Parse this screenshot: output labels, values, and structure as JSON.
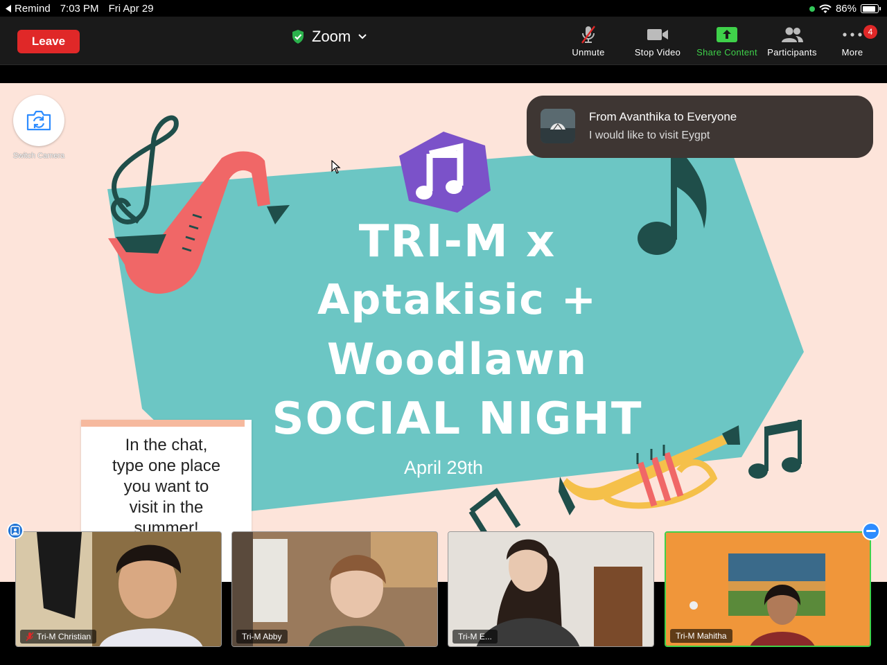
{
  "status_bar": {
    "back_app": "Remind",
    "time": "7:03 PM",
    "date": "Fri Apr 29",
    "battery": "86%",
    "battery_level": 0.86
  },
  "toolbar": {
    "leave_label": "Leave",
    "meeting_title": "Zoom",
    "buttons": [
      {
        "label": "Unmute",
        "icon": "mic-muted-icon"
      },
      {
        "label": "Stop Video",
        "icon": "video-camera-icon"
      },
      {
        "label": "Share Content",
        "icon": "share-arrow-icon"
      },
      {
        "label": "Participants",
        "icon": "participants-icon"
      },
      {
        "label": "More",
        "icon": "more-dots-icon",
        "badge": "4"
      }
    ],
    "share_color": "#3fd14a",
    "leave_color": "#e02828"
  },
  "switch_camera": {
    "label": "Switch Camera"
  },
  "chat_notification": {
    "from": "From Avanthika to Everyone",
    "message": "I would like to visit Eygpt"
  },
  "slide": {
    "title_lines": [
      "TRI-M x",
      "Aptakisic +",
      "Woodlawn",
      "SOCIAL NIGHT"
    ],
    "date": "April 29th",
    "note_lines": [
      "In the chat,",
      "type one place",
      "you want to",
      "visit in the",
      "summer!"
    ],
    "colors": {
      "background": "#fde4da",
      "panel": "#6cc6c4",
      "hexagon": "#7b52c9",
      "accent_red": "#f06767",
      "accent_yellow": "#f5c04a",
      "dark_teal": "#1f4e4a"
    }
  },
  "participants": [
    {
      "name": "Tri-M Christian",
      "muted": true
    },
    {
      "name": "Tri-M Abby",
      "muted": false
    },
    {
      "name": "Tri-M E...",
      "muted": false
    },
    {
      "name": "Tri-M Mahitha",
      "muted": false,
      "active_speaker": true
    }
  ]
}
